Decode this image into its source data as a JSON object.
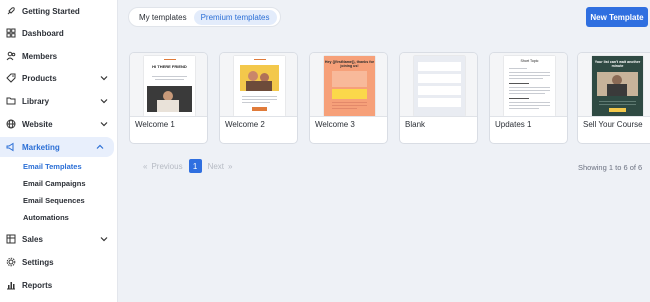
{
  "sidebar": {
    "items": [
      {
        "label": "Getting Started",
        "icon": "rocket-icon"
      },
      {
        "label": "Dashboard",
        "icon": "grid-icon"
      },
      {
        "label": "Members",
        "icon": "users-icon"
      },
      {
        "label": "Products",
        "icon": "tag-icon"
      },
      {
        "label": "Library",
        "icon": "folder-icon"
      },
      {
        "label": "Website",
        "icon": "globe-icon"
      },
      {
        "label": "Marketing",
        "icon": "megaphone-icon"
      },
      {
        "label": "Sales",
        "icon": "table-icon"
      },
      {
        "label": "Settings",
        "icon": "gear-icon"
      },
      {
        "label": "Reports",
        "icon": "chart-icon"
      }
    ],
    "marketing_sub": [
      "Email Templates",
      "Email Campaigns",
      "Email Sequences",
      "Automations"
    ]
  },
  "tabs": {
    "my": "My templates",
    "premium": "Premium templates"
  },
  "new_template_label": "New Template",
  "templates": [
    {
      "name": "Welcome 1",
      "headline": "HI THERE FRIEND"
    },
    {
      "name": "Welcome 2"
    },
    {
      "name": "Welcome 3",
      "headline": "Hey {{firstName}}, thanks for joining us!"
    },
    {
      "name": "Blank"
    },
    {
      "name": "Updates 1",
      "headline": "Short Topic"
    },
    {
      "name": "Sell Your Course",
      "headline": "Your list can't wait another minute"
    }
  ],
  "pagination": {
    "previous": "Previous",
    "current": "1",
    "next": "Next",
    "prev_arrows": "«",
    "next_arrows": "»"
  },
  "status": "Showing 1 to 6 of 6",
  "colors": {
    "accent": "#2f6fe0",
    "active_bg": "#e8effc",
    "background": "#eef1f6"
  }
}
